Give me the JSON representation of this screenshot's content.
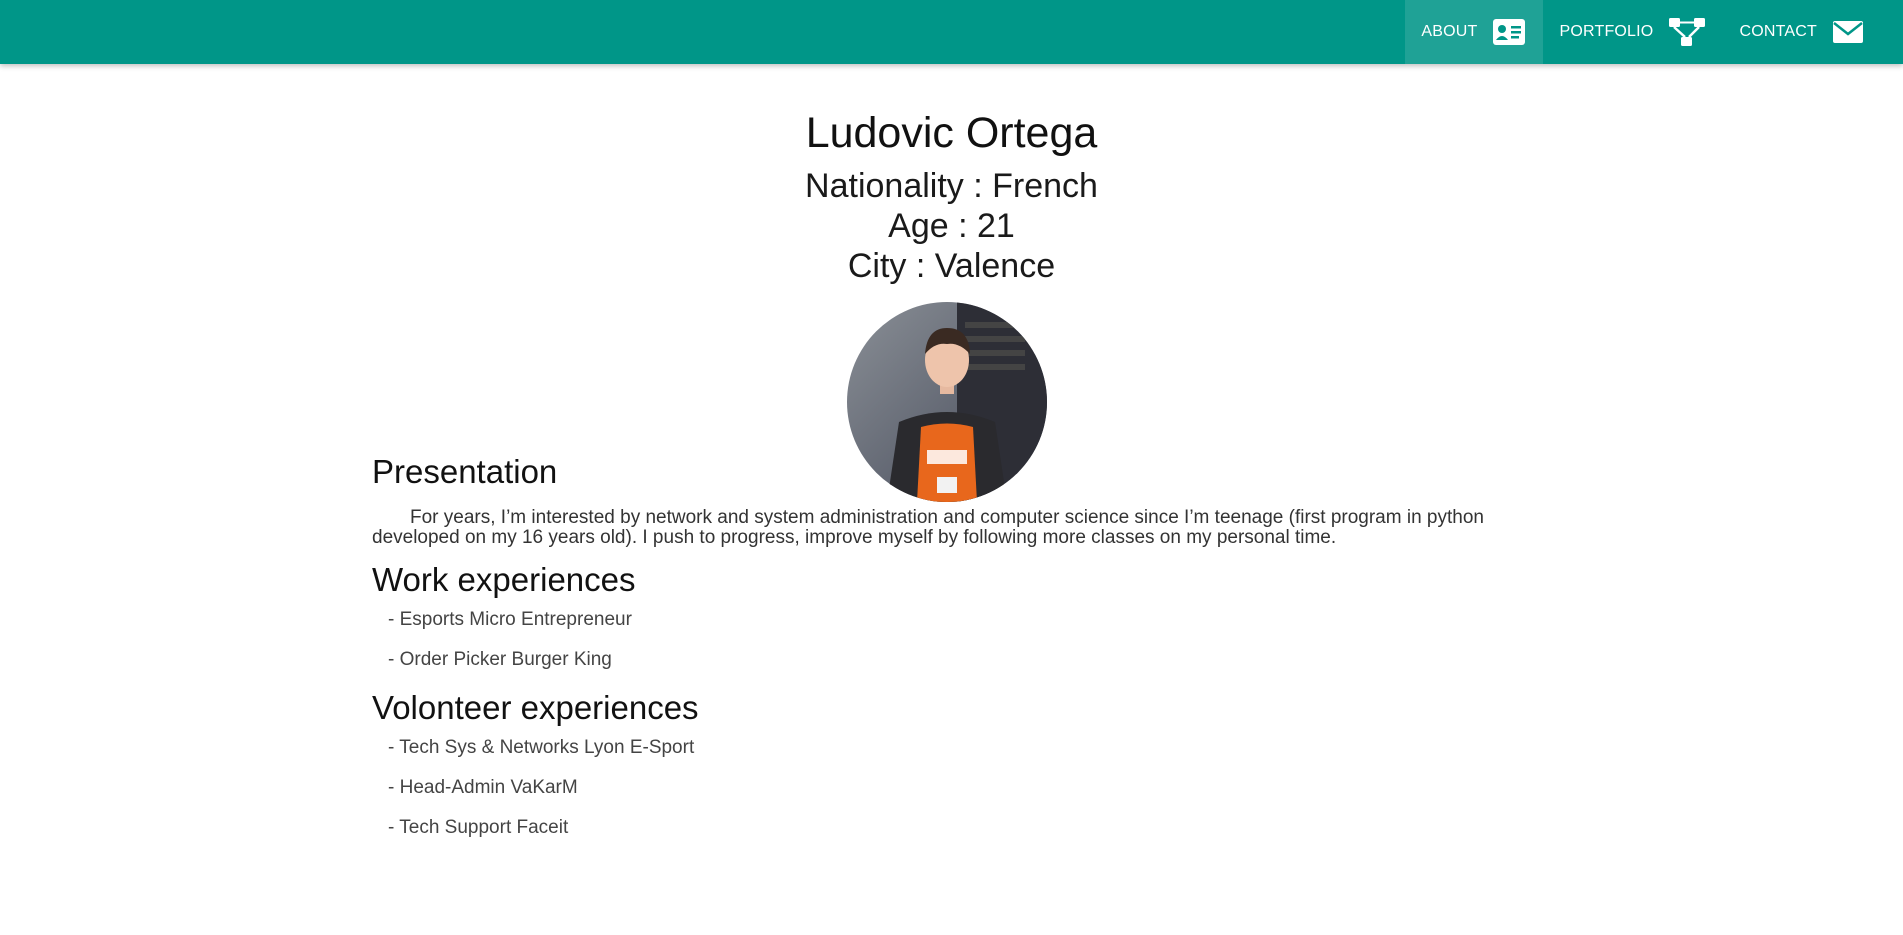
{
  "nav": {
    "items": [
      {
        "label": "ABOUT",
        "icon": "id-card-icon",
        "active": true
      },
      {
        "label": "PORTFOLIO",
        "icon": "sitemap-icon",
        "active": false
      },
      {
        "label": "CONTACT",
        "icon": "envelope-icon",
        "active": false
      }
    ]
  },
  "profile": {
    "name": "Ludovic Ortega",
    "nationality": "Nationality : French",
    "age": "Age : 21",
    "city": "City : Valence"
  },
  "presentation": {
    "title": "Presentation",
    "text": "For years, I’m interested by network and system administration and computer science since I’m teenage (first program in python developed on my 16 years old). I push to progress, improve myself by following more classes on my personal time."
  },
  "work": {
    "title": "Work experiences",
    "items": [
      "- Esports Micro Entrepreneur",
      "- Order Picker Burger King"
    ]
  },
  "volunteer": {
    "title": "Volonteer experiences",
    "items": [
      "- Tech Sys & Networks Lyon E-Sport",
      "- Head-Admin VaKarM",
      "- Tech Support Faceit"
    ]
  },
  "colors": {
    "navbar": "#009688",
    "text": "#111111"
  }
}
